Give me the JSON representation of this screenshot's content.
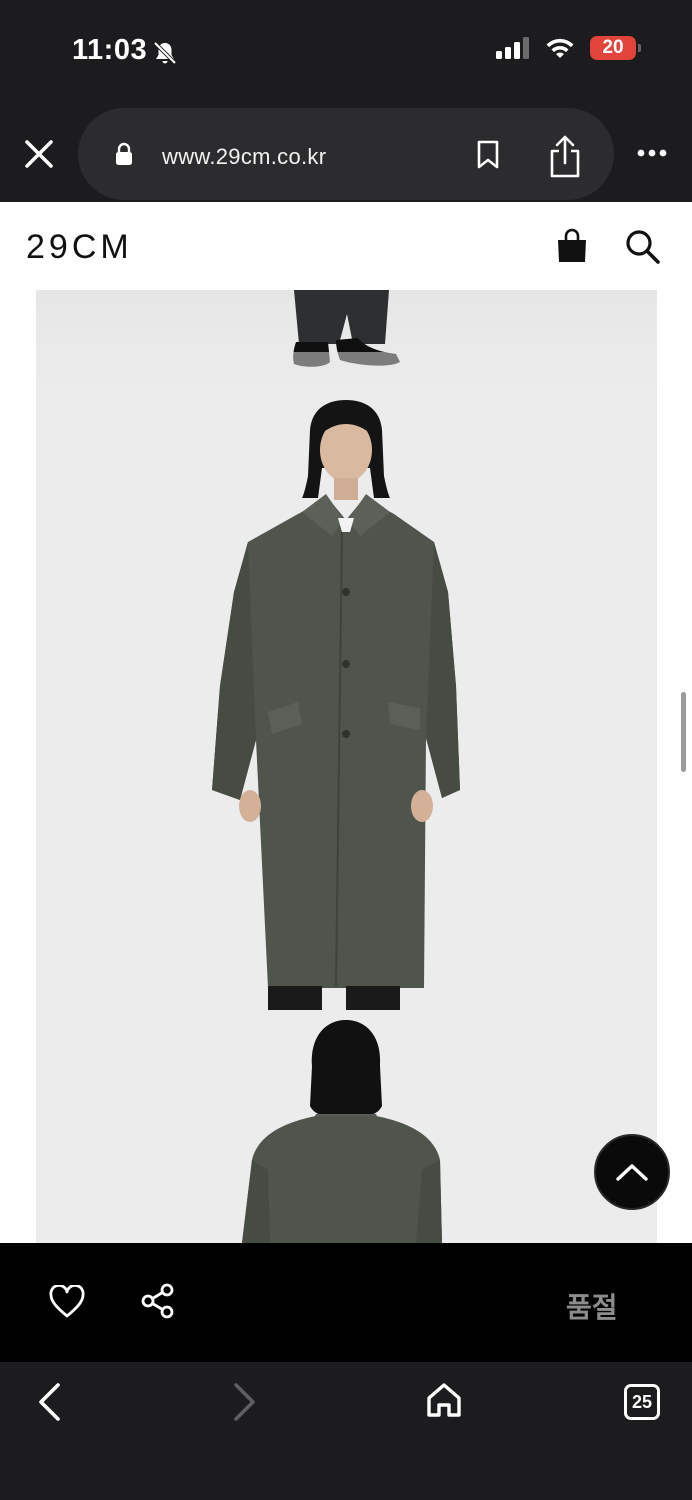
{
  "status": {
    "time": "11:03",
    "battery": "20"
  },
  "browser": {
    "url": "www.29cm.co.kr",
    "tab_count": "25"
  },
  "site": {
    "logo": "29CM"
  },
  "product": {
    "status_label": "품절"
  },
  "icons": {
    "close": "close-icon",
    "lock": "lock-icon",
    "bookmark": "bookmark-icon",
    "share": "share-icon",
    "more": "more-icon",
    "bag": "shopping-bag-icon",
    "search": "search-icon",
    "heart": "heart-icon",
    "share_nodes": "share-nodes-icon",
    "back": "chevron-left-icon",
    "forward": "chevron-right-icon",
    "home": "home-icon",
    "scroll_top": "chevron-up-icon"
  },
  "colors": {
    "chrome_bg": "#1c1c1e",
    "battery_red": "#e0443a",
    "coat_gray": "#4f554d"
  }
}
